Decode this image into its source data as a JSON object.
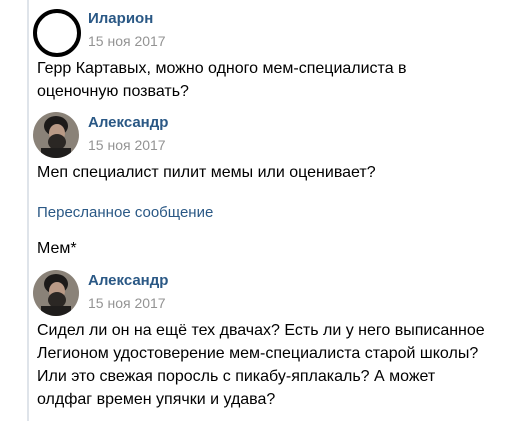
{
  "messages": [
    {
      "author": "Иларион",
      "date": "15 ноя 2017",
      "avatar": "empty-circle-avatar",
      "lines": [
        "Герр Картавых, можно одного мем-специалиста в",
        "оценочную позвать?"
      ]
    },
    {
      "author": "Александр",
      "date": "15 ноя 2017",
      "avatar": "bearded-man-photo",
      "lines": [
        "Меп специалист пилит мемы или оценивает?"
      ]
    },
    {
      "forwarded_label": "Пересланное сообщение",
      "lines": [
        "Мем*"
      ]
    },
    {
      "author": "Александр",
      "date": "15 ноя 2017",
      "avatar": "bearded-man-photo",
      "lines": [
        "Сидел ли он на ещё тех двачах? Есть ли у него выписанное",
        "Легионом удостоверение мем-специалиста старой школы?",
        "Или это свежая поросль с пикабу-яплакаль? А может",
        "олдфаг времен упячки и удава?"
      ]
    }
  ],
  "colors": {
    "author_link": "#2a5885",
    "date": "#939393",
    "thread_bar": "#dfe4ea"
  }
}
